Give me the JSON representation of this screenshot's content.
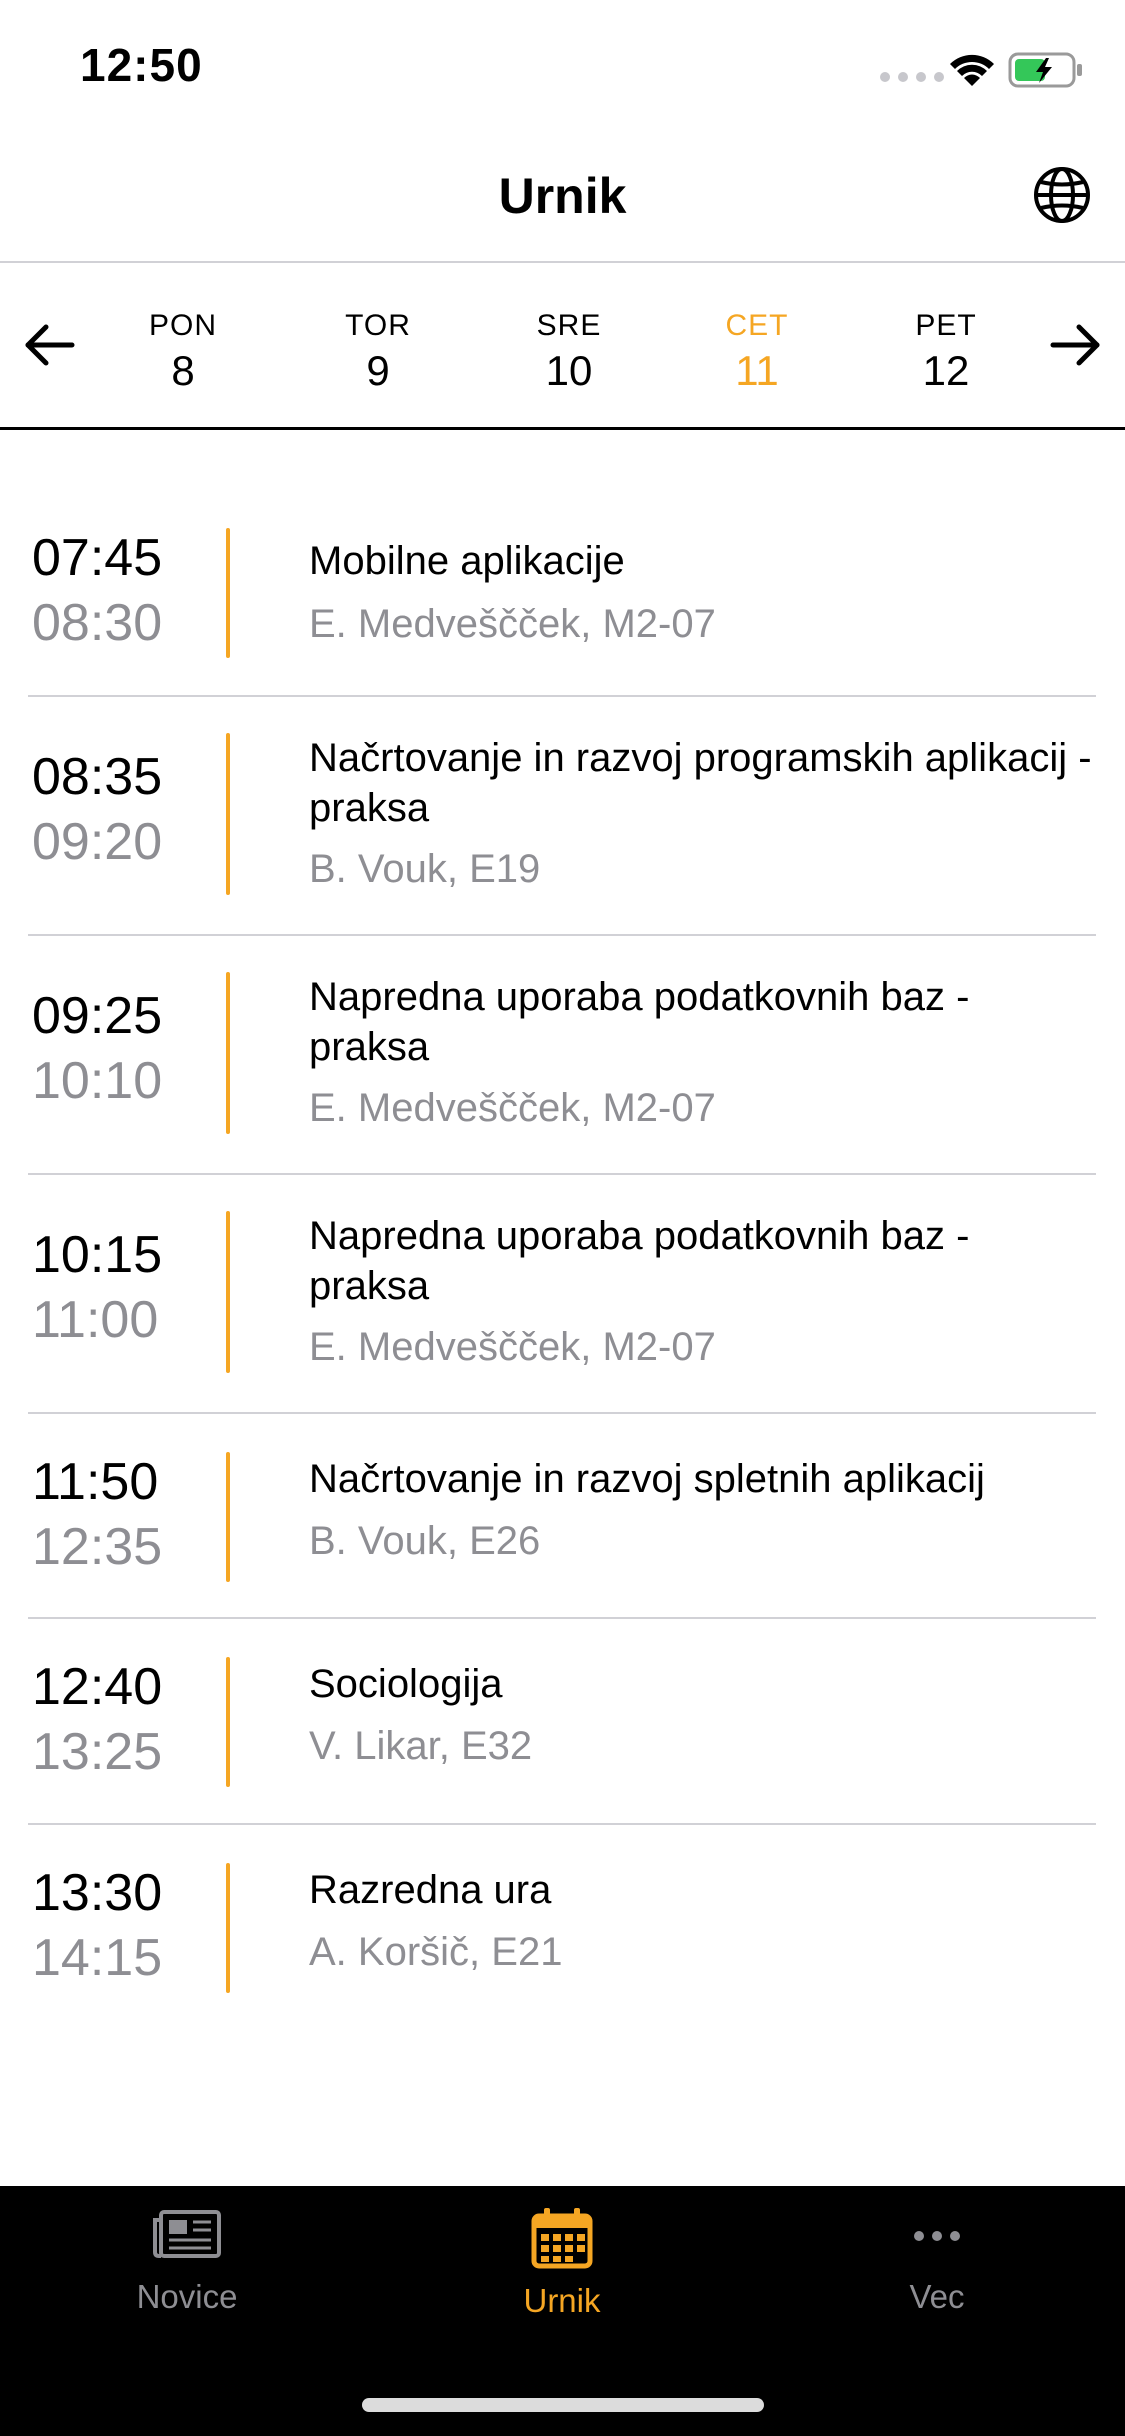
{
  "status_bar": {
    "time": "12:50"
  },
  "nav": {
    "title": "Urnik",
    "globe_icon": "globe-icon"
  },
  "week": {
    "days": [
      {
        "name": "PON",
        "number": "8"
      },
      {
        "name": "TOR",
        "number": "9"
      },
      {
        "name": "SRE",
        "number": "10"
      },
      {
        "name": "CET",
        "number": "11",
        "selected": true
      },
      {
        "name": "PET",
        "number": "12"
      }
    ],
    "accent_color": "#f5a623"
  },
  "schedule": [
    {
      "start": "07:45",
      "end": "08:30",
      "subject": "Mobilne aplikacije",
      "meta": "E. Medveščček, M2-07"
    },
    {
      "start": "08:35",
      "end": "09:20",
      "subject": "Načrtovanje in razvoj programskih aplikacij - praksa",
      "meta": "B. Vouk, E19"
    },
    {
      "start": "09:25",
      "end": "10:10",
      "subject": "Napredna uporaba podatkovnih baz - praksa",
      "meta": "E. Medveščček, M2-07"
    },
    {
      "start": "10:15",
      "end": "11:00",
      "subject": "Napredna uporaba podatkovnih baz - praksa",
      "meta": "E. Medveščček, M2-07"
    },
    {
      "start": "11:50",
      "end": "12:35",
      "subject": "Načrtovanje in razvoj spletnih aplikacij",
      "meta": "B. Vouk, E26"
    },
    {
      "start": "12:40",
      "end": "13:25",
      "subject": "Sociologija",
      "meta": "V. Likar, E32"
    },
    {
      "start": "13:30",
      "end": "14:15",
      "subject": "Razredna ura",
      "meta": "A. Koršič, E21"
    }
  ],
  "tabs": [
    {
      "label": "Novice",
      "icon": "newspaper-icon"
    },
    {
      "label": "Urnik",
      "icon": "calendar-icon",
      "active": true
    },
    {
      "label": "Vec",
      "icon": "more-icon"
    }
  ]
}
